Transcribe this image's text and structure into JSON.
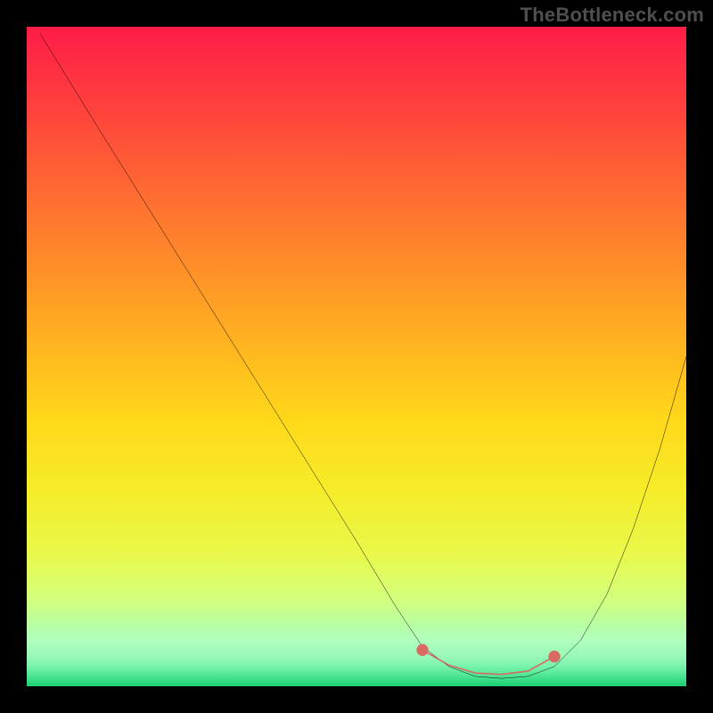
{
  "watermark": "TheBottleneck.com",
  "chart_data": {
    "type": "line",
    "title": "",
    "xlabel": "",
    "ylabel": "",
    "xlim": [
      0,
      100
    ],
    "ylim": [
      0,
      100
    ],
    "series": [
      {
        "name": "curve",
        "color": "#000000",
        "x": [
          2,
          10,
          20,
          30,
          40,
          50,
          56,
          60,
          64,
          68,
          72,
          76,
          80,
          84,
          88,
          92,
          96,
          100
        ],
        "y": [
          99,
          86,
          70,
          54,
          38,
          22,
          12,
          6,
          3,
          1.5,
          1.2,
          1.5,
          3,
          7,
          14,
          24,
          36,
          50
        ]
      }
    ],
    "markers": [
      {
        "name": "bottleneck-range-start",
        "x": 60,
        "y": 5.5,
        "color": "#d86a63"
      },
      {
        "name": "bottleneck-range-end",
        "x": 80,
        "y": 4.5,
        "color": "#d86a63"
      }
    ],
    "thick_segment": {
      "name": "bottleneck-range-band",
      "color": "#d86a63",
      "x": [
        60,
        64,
        68,
        72,
        76,
        80
      ],
      "y": [
        5.5,
        3.2,
        2.0,
        1.8,
        2.3,
        4.5
      ]
    },
    "background_gradient": {
      "stops": [
        {
          "pos": 0,
          "color": "#ff1c47"
        },
        {
          "pos": 50,
          "color": "#ffd91a"
        },
        {
          "pos": 85,
          "color": "#e9f84a"
        },
        {
          "pos": 100,
          "color": "#17d172"
        }
      ]
    }
  }
}
